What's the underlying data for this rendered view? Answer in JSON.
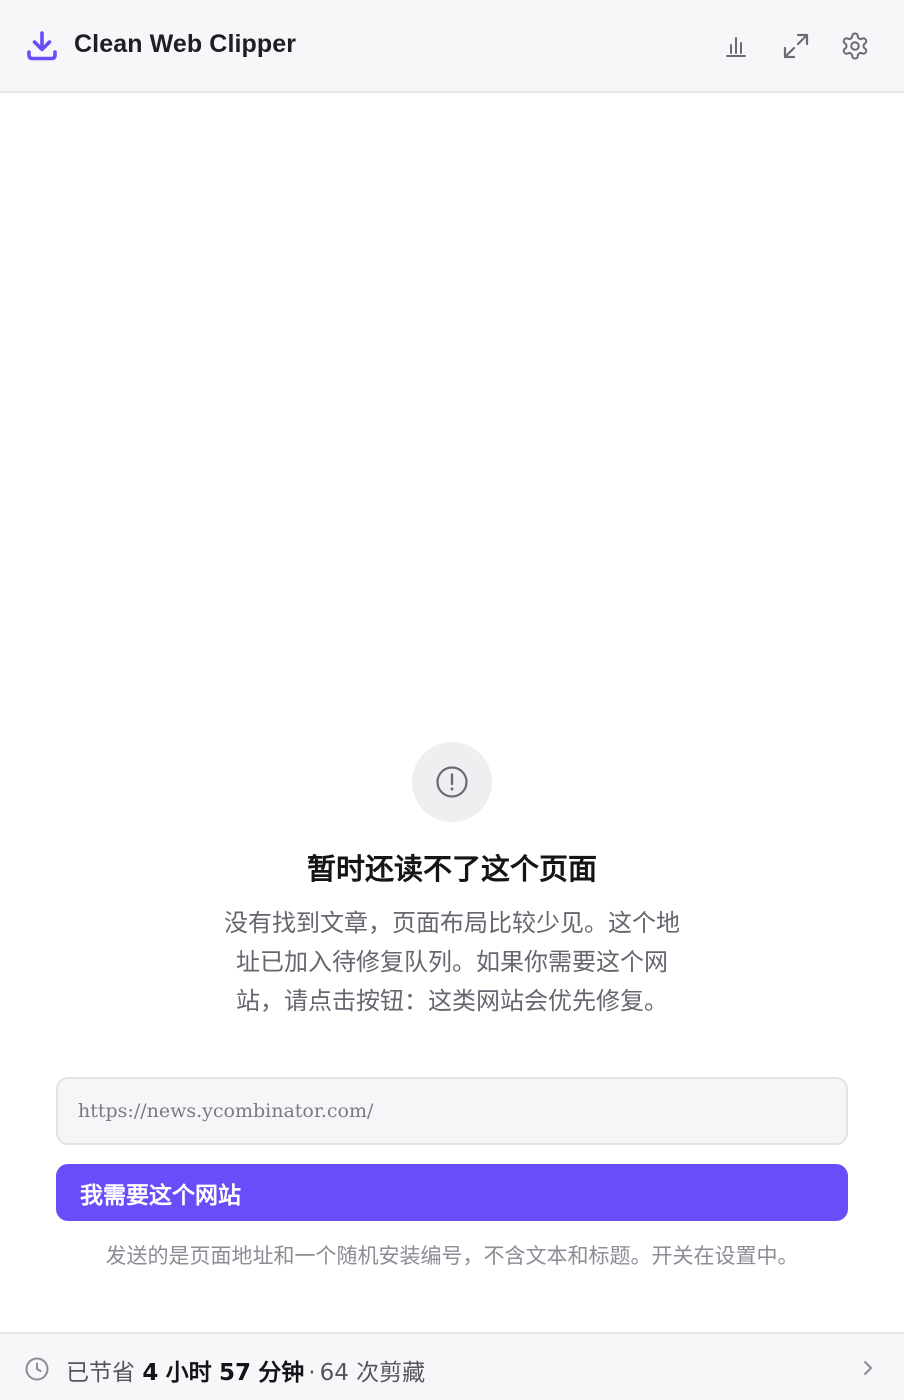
{
  "header": {
    "title": "Clean Web Clipper",
    "icons": [
      "download-logo-icon",
      "stats-chart-icon",
      "expand-icon",
      "settings-gear-icon"
    ],
    "accent_color": "#6a4df9"
  },
  "empty_state": {
    "icon": "alert-circle-icon",
    "title": "暂时还读不了这个页面",
    "description": "没有找到文章，页面布局比较少见。这个地址已加入待修复队列。如果你需要这个网站，请点击按钮：这类网站会优先修复。"
  },
  "url_field": {
    "value": "https://news.ycombinator.com/"
  },
  "request_button": {
    "label": "我需要这个网站"
  },
  "privacy_note": "发送的是页面地址和一个随机安装编号，不含文本和标题。开关在设置中。",
  "footer": {
    "prefix": "已节省",
    "hours": "4",
    "hours_unit": "小时",
    "minutes": "57",
    "minutes_unit": "分钟",
    "separator": "·",
    "clips": "64 次剪藏",
    "icons": [
      "clock-icon",
      "chevron-right-icon"
    ]
  }
}
